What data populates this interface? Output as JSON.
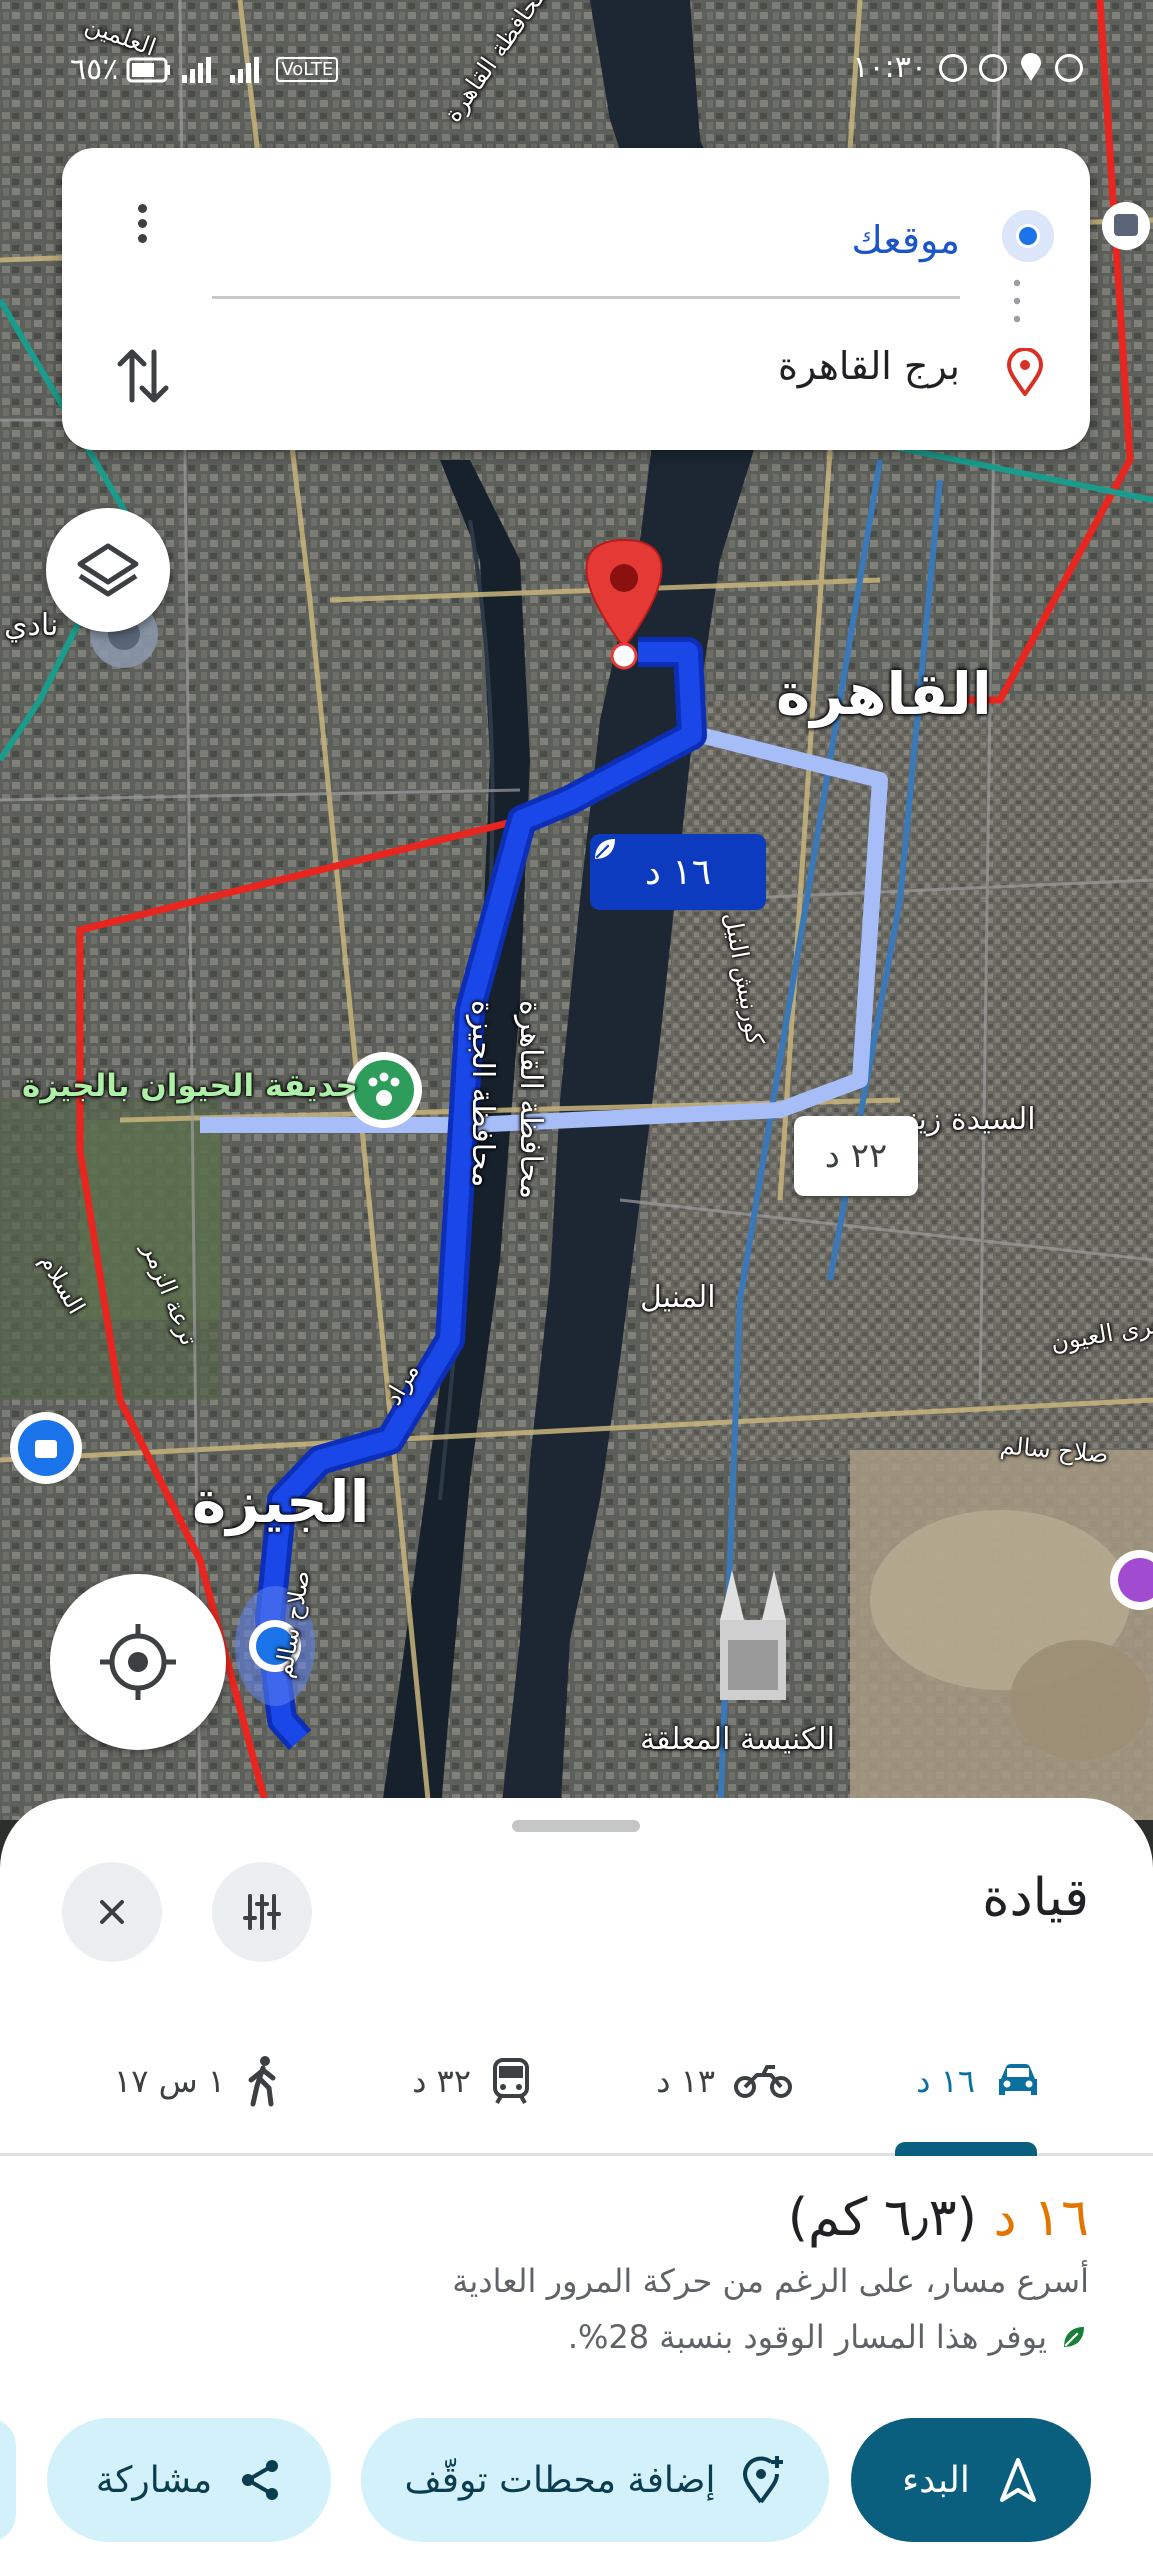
{
  "status_bar": {
    "time": "١٠:٣٠",
    "battery": "٦٥٪",
    "network": "VoLTE"
  },
  "search": {
    "origin": "موقعك",
    "destination": "برج القاهرة"
  },
  "map": {
    "labels": {
      "cairo": "القاهرة",
      "giza": "الجيزة",
      "zoo": "حديقة الحيوان بالجيزة",
      "manial": "المنيل",
      "hanging_church": "الكنيسة المعلقة",
      "sayeda": "السيدة زينب",
      "giza_gov": "محافظة الجيزة",
      "cairo_gov": "محافظة القاهرة",
      "corniche": "كورنيش النيل",
      "salah_salem": "صلاح سالم",
      "ain": "مجرى العيون",
      "club": "نادي",
      "alamein": "العلمين",
      "cairo_top": "محافظة القاهرة",
      "murad": "مراد",
      "salam": "السلام",
      "zomor": "ترعة الزمر",
      "salah": "صلاح سالم"
    },
    "route_primary_time": "١٦ د",
    "route_alt_time": "٢٢ د"
  },
  "sheet": {
    "title": "قيادة",
    "modes": [
      {
        "name": "driving",
        "label": "١٦ د"
      },
      {
        "name": "motorcycle",
        "label": "١٣ د"
      },
      {
        "name": "transit",
        "label": "٣٢ د"
      },
      {
        "name": "walking",
        "label": "١ س ١٧"
      }
    ],
    "summary": {
      "time": "١٦ د",
      "distance": "(٦٫٣ كم)",
      "description": "أسرع مسار، على الرغم من حركة المرور العادية",
      "fuel": "يوفر هذا المسار الوقود بنسبة 28%."
    },
    "actions": {
      "start": "البدء",
      "add_stops": "إضافة محطات توقّف",
      "share": "مشاركة"
    }
  },
  "colors": {
    "route_primary": "#1a47e8",
    "route_alt": "#a7bdf8",
    "accent": "#0b5f7e",
    "eta": "#e37400"
  }
}
